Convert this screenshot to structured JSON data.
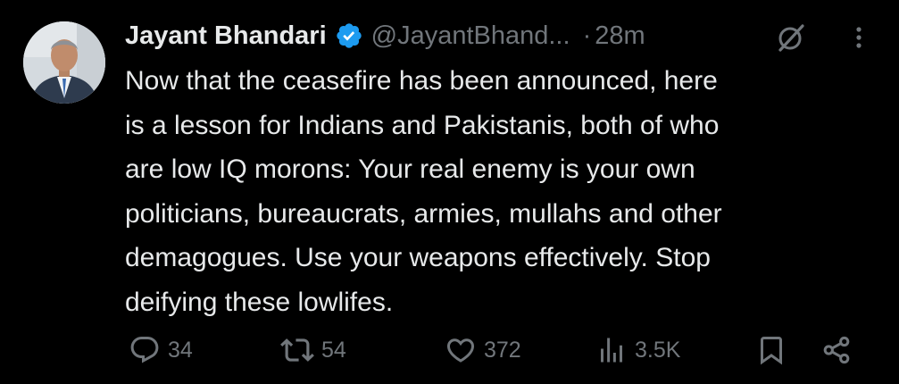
{
  "tweet": {
    "display_name": "Jayant Bhandari",
    "handle": "@JayantBhand...",
    "separator": "·",
    "timestamp": "28m",
    "verified": true,
    "text": "Now that the ceasefire has been announced, here\nis a lesson for Indians and Pakistanis, both of who\nare low IQ morons: Your real enemy is your own\npoliticians, bureaucrats, armies, mullahs and other\ndemagogues. Use your weapons effectively. Stop\ndeifying these lowlifes."
  },
  "actions": {
    "replies": "34",
    "reposts": "54",
    "likes": "372",
    "views": "3.5K"
  },
  "icons": {
    "avatar": "avatar-photo",
    "verified": "verified-badge-icon",
    "grok": "grok-icon",
    "more": "more-options-icon",
    "reply": "reply-icon",
    "repost": "repost-icon",
    "like": "heart-icon",
    "views": "views-chart-icon",
    "bookmark": "bookmark-icon",
    "share": "share-icon"
  },
  "colors": {
    "background": "#000000",
    "text_primary": "#e7e9ea",
    "text_secondary": "#71767b",
    "verified_blue": "#1d9bf0"
  }
}
